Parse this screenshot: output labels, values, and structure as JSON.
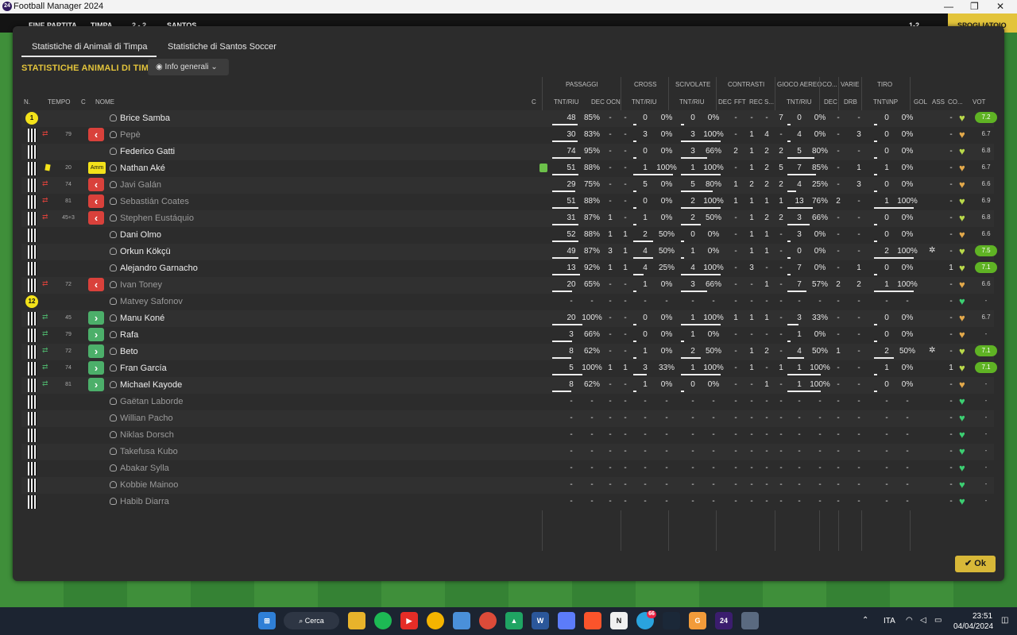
{
  "window": {
    "title": "Football Manager 2024"
  },
  "match": {
    "status": "FINE PARTITA",
    "home": "TIMPA",
    "score": "2 - 2",
    "away": "SANTOS",
    "right_label": "SPOGLIATOIO",
    "mini_score": "1-2"
  },
  "tabs": [
    "Statistiche di Animali di Timpa",
    "Statistiche di Santos Soccer"
  ],
  "section_title": "STATISTICHE ANIMALI DI TIMPA",
  "view_dropdown": "Info generali",
  "groups": [
    "PASSAGGI",
    "CROSS",
    "SCIVOLATE",
    "CONTRASTI",
    "GIOCO AEREO",
    "CO...",
    "VARIE",
    "TIRO"
  ],
  "columns": [
    "N.",
    "TEMPO",
    "C",
    "NOME",
    "C",
    "TNT/RIU",
    "DEC",
    "OCN",
    "TNT/RIU",
    "TNT/RIU",
    "DEC",
    "FFT",
    "REC",
    "S...",
    "TNT/RIU",
    "DEC",
    "DRB",
    "TNT\\INP",
    "GOL",
    "ASS",
    "CO...",
    "VOT"
  ],
  "players": [
    {
      "num": "1",
      "min": "",
      "sub": "",
      "name": "Brice Samba",
      "p": [
        "48",
        "85%"
      ],
      "pdec": "-",
      "pocn": "-",
      "cr": [
        "0",
        "0%"
      ],
      "sc": [
        "0",
        "0%"
      ],
      "ct": [
        "-",
        "-",
        "-",
        "7"
      ],
      "ae": [
        "0",
        "0%"
      ],
      "co": "-",
      "drb": "-",
      "sh": [
        "0",
        "0%"
      ],
      "gol": "",
      "ass": "-",
      "rating": "7.2"
    },
    {
      "num": "",
      "min": "79",
      "sub": "out",
      "name": "Pepè",
      "p": [
        "30",
        "83%"
      ],
      "pdec": "-",
      "pocn": "-",
      "cr": [
        "3",
        "0%"
      ],
      "sc": [
        "3",
        "100%"
      ],
      "ct": [
        "-",
        "1",
        "4",
        "-"
      ],
      "ae": [
        "4",
        "0%"
      ],
      "co": "-",
      "drb": "3",
      "sh": [
        "0",
        "0%"
      ],
      "gol": "",
      "ass": "-",
      "rating": "6.7"
    },
    {
      "num": "",
      "min": "",
      "sub": "",
      "name": "Federico Gatti",
      "p": [
        "74",
        "95%"
      ],
      "pdec": "-",
      "pocn": "-",
      "cr": [
        "0",
        "0%"
      ],
      "sc": [
        "3",
        "66%"
      ],
      "ct": [
        "2",
        "1",
        "2",
        "2"
      ],
      "ae": [
        "5",
        "80%"
      ],
      "co": "-",
      "drb": "-",
      "sh": [
        "0",
        "0%"
      ],
      "gol": "",
      "ass": "-",
      "rating": "6.8"
    },
    {
      "num": "",
      "min": "20",
      "sub": "Amm",
      "name": "Nathan Aké",
      "p": [
        "51",
        "88%"
      ],
      "pdec": "-",
      "pocn": "-",
      "cr": [
        "1",
        "100%"
      ],
      "sc": [
        "1",
        "100%"
      ],
      "ct": [
        "-",
        "1",
        "2",
        "5"
      ],
      "ae": [
        "7",
        "85%"
      ],
      "co": "-",
      "drb": "1",
      "sh": [
        "1",
        "0%"
      ],
      "gol": "",
      "ass": "-",
      "rating": "6.7"
    },
    {
      "num": "",
      "min": "74",
      "sub": "out",
      "name": "Javi Galán",
      "p": [
        "29",
        "75%"
      ],
      "pdec": "-",
      "pocn": "-",
      "cr": [
        "5",
        "0%"
      ],
      "sc": [
        "5",
        "80%"
      ],
      "ct": [
        "1",
        "2",
        "2",
        "2"
      ],
      "ae": [
        "4",
        "25%"
      ],
      "co": "-",
      "drb": "3",
      "sh": [
        "0",
        "0%"
      ],
      "gol": "",
      "ass": "-",
      "rating": "6.6"
    },
    {
      "num": "",
      "min": "81",
      "sub": "out",
      "name": "Sebastián Coates",
      "p": [
        "51",
        "88%"
      ],
      "pdec": "-",
      "pocn": "-",
      "cr": [
        "0",
        "0%"
      ],
      "sc": [
        "2",
        "100%"
      ],
      "ct": [
        "1",
        "1",
        "1",
        "1"
      ],
      "ae": [
        "13",
        "76%"
      ],
      "co": "2",
      "drb": "-",
      "sh": [
        "1",
        "100%"
      ],
      "gol": "",
      "ass": "-",
      "rating": "6.9"
    },
    {
      "num": "",
      "min": "45+3",
      "sub": "out",
      "name": "Stephen Eustáquio",
      "p": [
        "31",
        "87%"
      ],
      "pdec": "1",
      "pocn": "-",
      "cr": [
        "1",
        "0%"
      ],
      "sc": [
        "2",
        "50%"
      ],
      "ct": [
        "-",
        "1",
        "2",
        "2"
      ],
      "ae": [
        "3",
        "66%"
      ],
      "co": "-",
      "drb": "-",
      "sh": [
        "0",
        "0%"
      ],
      "gol": "",
      "ass": "-",
      "rating": "6.8"
    },
    {
      "num": "",
      "min": "",
      "sub": "",
      "name": "Dani Olmo",
      "p": [
        "52",
        "88%"
      ],
      "pdec": "1",
      "pocn": "1",
      "cr": [
        "2",
        "50%"
      ],
      "sc": [
        "0",
        "0%"
      ],
      "ct": [
        "-",
        "1",
        "1",
        "-"
      ],
      "ae": [
        "3",
        "0%"
      ],
      "co": "-",
      "drb": "-",
      "sh": [
        "0",
        "0%"
      ],
      "gol": "",
      "ass": "-",
      "rating": "6.6"
    },
    {
      "num": "",
      "min": "",
      "sub": "",
      "name": "Orkun Kökçü",
      "p": [
        "49",
        "87%"
      ],
      "pdec": "3",
      "pocn": "1",
      "cr": [
        "4",
        "50%"
      ],
      "sc": [
        "1",
        "0%"
      ],
      "ct": [
        "-",
        "1",
        "1",
        "-"
      ],
      "ae": [
        "0",
        "0%"
      ],
      "co": "-",
      "drb": "-",
      "sh": [
        "2",
        "100%"
      ],
      "gol": "ball",
      "ass": "-",
      "rating": "7.5"
    },
    {
      "num": "",
      "min": "",
      "sub": "",
      "name": "Alejandro Garnacho",
      "p": [
        "13",
        "92%"
      ],
      "pdec": "1",
      "pocn": "1",
      "cr": [
        "4",
        "25%"
      ],
      "sc": [
        "4",
        "100%"
      ],
      "ct": [
        "-",
        "3",
        "-",
        "-"
      ],
      "ae": [
        "7",
        "0%"
      ],
      "co": "-",
      "drb": "1",
      "sh": [
        "0",
        "0%"
      ],
      "gol": "",
      "ass": "1",
      "rating": "7.1"
    },
    {
      "num": "",
      "min": "72",
      "sub": "out",
      "name": "Ivan Toney",
      "p": [
        "20",
        "65%"
      ],
      "pdec": "-",
      "pocn": "-",
      "cr": [
        "1",
        "0%"
      ],
      "sc": [
        "3",
        "66%"
      ],
      "ct": [
        "-",
        "-",
        "1",
        "-"
      ],
      "ae": [
        "7",
        "57%"
      ],
      "co": "2",
      "drb": "2",
      "sh": [
        "1",
        "100%"
      ],
      "gol": "",
      "ass": "-",
      "rating": "6.6"
    },
    {
      "num": "12",
      "min": "",
      "sub": "",
      "name": "Matvey Safonov",
      "p": [
        "-",
        "-"
      ],
      "pdec": "-",
      "pocn": "-",
      "cr": [
        "-",
        "-"
      ],
      "sc": [
        "-",
        "-"
      ],
      "ct": [
        "-",
        "-",
        "-",
        "-"
      ],
      "ae": [
        "-",
        "-"
      ],
      "co": "-",
      "drb": "-",
      "sh": [
        "-",
        "-"
      ],
      "gol": "",
      "ass": "-",
      "rating": "-"
    },
    {
      "num": "",
      "min": "45",
      "sub": "in",
      "name": "Manu Koné",
      "p": [
        "20",
        "100%"
      ],
      "pdec": "-",
      "pocn": "-",
      "cr": [
        "0",
        "0%"
      ],
      "sc": [
        "1",
        "100%"
      ],
      "ct": [
        "1",
        "1",
        "1",
        "-"
      ],
      "ae": [
        "3",
        "33%"
      ],
      "co": "-",
      "drb": "-",
      "sh": [
        "0",
        "0%"
      ],
      "gol": "",
      "ass": "-",
      "rating": "6.7"
    },
    {
      "num": "",
      "min": "79",
      "sub": "in",
      "name": "Rafa",
      "p": [
        "3",
        "66%"
      ],
      "pdec": "-",
      "pocn": "-",
      "cr": [
        "0",
        "0%"
      ],
      "sc": [
        "1",
        "0%"
      ],
      "ct": [
        "-",
        "-",
        "-",
        "-"
      ],
      "ae": [
        "1",
        "0%"
      ],
      "co": "-",
      "drb": "-",
      "sh": [
        "0",
        "0%"
      ],
      "gol": "",
      "ass": "-",
      "rating": "-"
    },
    {
      "num": "",
      "min": "72",
      "sub": "in",
      "name": "Beto",
      "p": [
        "8",
        "62%"
      ],
      "pdec": "-",
      "pocn": "-",
      "cr": [
        "1",
        "0%"
      ],
      "sc": [
        "2",
        "50%"
      ],
      "ct": [
        "-",
        "1",
        "2",
        "-"
      ],
      "ae": [
        "4",
        "50%"
      ],
      "co": "1",
      "drb": "-",
      "sh": [
        "2",
        "50%"
      ],
      "gol": "ball",
      "ass": "-",
      "rating": "7.1"
    },
    {
      "num": "",
      "min": "74",
      "sub": "in",
      "name": "Fran García",
      "p": [
        "5",
        "100%"
      ],
      "pdec": "1",
      "pocn": "1",
      "cr": [
        "3",
        "33%"
      ],
      "sc": [
        "1",
        "100%"
      ],
      "ct": [
        "-",
        "1",
        "-",
        "1"
      ],
      "ae": [
        "1",
        "100%"
      ],
      "co": "-",
      "drb": "-",
      "sh": [
        "1",
        "0%"
      ],
      "gol": "",
      "ass": "1",
      "rating": "7.1"
    },
    {
      "num": "",
      "min": "81",
      "sub": "in",
      "name": "Michael Kayode",
      "p": [
        "8",
        "62%"
      ],
      "pdec": "-",
      "pocn": "-",
      "cr": [
        "1",
        "0%"
      ],
      "sc": [
        "0",
        "0%"
      ],
      "ct": [
        "-",
        "-",
        "1",
        "-"
      ],
      "ae": [
        "1",
        "100%"
      ],
      "co": "-",
      "drb": "-",
      "sh": [
        "0",
        "0%"
      ],
      "gol": "",
      "ass": "-",
      "rating": "-"
    },
    {
      "num": "",
      "min": "",
      "sub": "",
      "name": "Gaëtan Laborde",
      "p": [
        "-",
        "-"
      ],
      "pdec": "-",
      "pocn": "-",
      "cr": [
        "-",
        "-"
      ],
      "sc": [
        "-",
        "-"
      ],
      "ct": [
        "-",
        "-",
        "-",
        "-"
      ],
      "ae": [
        "-",
        "-"
      ],
      "co": "-",
      "drb": "-",
      "sh": [
        "-",
        "-"
      ],
      "gol": "",
      "ass": "-",
      "rating": "-"
    },
    {
      "num": "",
      "min": "",
      "sub": "",
      "name": "Willian Pacho",
      "p": [
        "-",
        "-"
      ],
      "pdec": "-",
      "pocn": "-",
      "cr": [
        "-",
        "-"
      ],
      "sc": [
        "-",
        "-"
      ],
      "ct": [
        "-",
        "-",
        "-",
        "-"
      ],
      "ae": [
        "-",
        "-"
      ],
      "co": "-",
      "drb": "-",
      "sh": [
        "-",
        "-"
      ],
      "gol": "",
      "ass": "-",
      "rating": "-"
    },
    {
      "num": "",
      "min": "",
      "sub": "",
      "name": "Niklas Dorsch",
      "p": [
        "-",
        "-"
      ],
      "pdec": "-",
      "pocn": "-",
      "cr": [
        "-",
        "-"
      ],
      "sc": [
        "-",
        "-"
      ],
      "ct": [
        "-",
        "-",
        "-",
        "-"
      ],
      "ae": [
        "-",
        "-"
      ],
      "co": "-",
      "drb": "-",
      "sh": [
        "-",
        "-"
      ],
      "gol": "",
      "ass": "-",
      "rating": "-"
    },
    {
      "num": "",
      "min": "",
      "sub": "",
      "name": "Takefusa Kubo",
      "p": [
        "-",
        "-"
      ],
      "pdec": "-",
      "pocn": "-",
      "cr": [
        "-",
        "-"
      ],
      "sc": [
        "-",
        "-"
      ],
      "ct": [
        "-",
        "-",
        "-",
        "-"
      ],
      "ae": [
        "-",
        "-"
      ],
      "co": "-",
      "drb": "-",
      "sh": [
        "-",
        "-"
      ],
      "gol": "",
      "ass": "-",
      "rating": "-"
    },
    {
      "num": "",
      "min": "",
      "sub": "",
      "name": "Abakar Sylla",
      "p": [
        "-",
        "-"
      ],
      "pdec": "-",
      "pocn": "-",
      "cr": [
        "-",
        "-"
      ],
      "sc": [
        "-",
        "-"
      ],
      "ct": [
        "-",
        "-",
        "-",
        "-"
      ],
      "ae": [
        "-",
        "-"
      ],
      "co": "-",
      "drb": "-",
      "sh": [
        "-",
        "-"
      ],
      "gol": "",
      "ass": "-",
      "rating": "-"
    },
    {
      "num": "",
      "min": "",
      "sub": "",
      "name": "Kobbie Mainoo",
      "p": [
        "-",
        "-"
      ],
      "pdec": "-",
      "pocn": "-",
      "cr": [
        "-",
        "-"
      ],
      "sc": [
        "-",
        "-"
      ],
      "ct": [
        "-",
        "-",
        "-",
        "-"
      ],
      "ae": [
        "-",
        "-"
      ],
      "co": "-",
      "drb": "-",
      "sh": [
        "-",
        "-"
      ],
      "gol": "",
      "ass": "-",
      "rating": "-"
    },
    {
      "num": "",
      "min": "",
      "sub": "",
      "name": "Habib Diarra",
      "p": [
        "-",
        "-"
      ],
      "pdec": "-",
      "pocn": "-",
      "cr": [
        "-",
        "-"
      ],
      "sc": [
        "-",
        "-"
      ],
      "ct": [
        "-",
        "-",
        "-",
        "-"
      ],
      "ae": [
        "-",
        "-"
      ],
      "co": "-",
      "drb": "-",
      "sh": [
        "-",
        "-"
      ],
      "gol": "",
      "ass": "-",
      "rating": "-"
    }
  ],
  "ok_button": "Ok",
  "taskbar": {
    "search": "Cerca",
    "lang": "ITA",
    "time": "23:51",
    "date": "04/04/2024",
    "badge": "66"
  },
  "colors": {
    "accent": "#e3c43b",
    "sub_out": "#d9413b",
    "sub_in": "#4caf6a",
    "rating_high": "#5fb324",
    "heart": "#3ccf72"
  }
}
